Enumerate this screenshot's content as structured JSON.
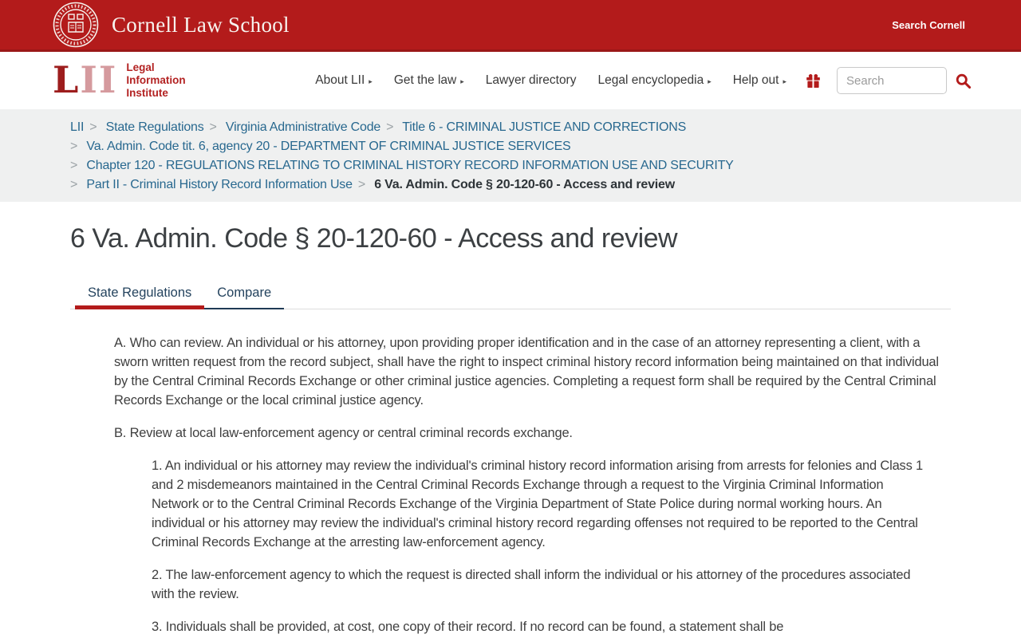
{
  "header": {
    "university": "Cornell Law School",
    "search_cornell": "Search Cornell"
  },
  "nav": {
    "logo": {
      "l": "L",
      "ii": "II",
      "line1": "Legal",
      "line2": "Information",
      "line3": "Institute"
    },
    "arrow": "▸",
    "items": [
      {
        "label": "About LII",
        "has_arrow": true
      },
      {
        "label": "Get the law",
        "has_arrow": true
      },
      {
        "label": "Lawyer directory",
        "has_arrow": false
      },
      {
        "label": "Legal encyclopedia",
        "has_arrow": true
      },
      {
        "label": "Help out",
        "has_arrow": true
      }
    ],
    "search": {
      "placeholder": "Search"
    }
  },
  "breadcrumb": {
    "separator": ">",
    "links": [
      "LII",
      "State Regulations",
      "Virginia Administrative Code",
      "Title 6 - CRIMINAL JUSTICE AND CORRECTIONS",
      "Va. Admin. Code tit. 6, agency 20 - DEPARTMENT OF CRIMINAL JUSTICE SERVICES",
      "Chapter 120 - REGULATIONS RELATING TO CRIMINAL HISTORY RECORD INFORMATION USE AND SECURITY",
      "Part II - Criminal History Record Information Use"
    ],
    "current": "6 Va. Admin. Code § 20-120-60 - Access and review"
  },
  "main": {
    "title": "6 Va. Admin. Code § 20-120-60 - Access and review",
    "tabs": [
      {
        "label": "State Regulations",
        "active": true
      },
      {
        "label": "Compare",
        "active": false
      }
    ],
    "paragraphs": [
      {
        "level": 1,
        "text": "A. Who can review. An individual or his attorney, upon providing proper identification and in the case of an attorney representing a client, with a sworn written request from the record subject, shall have the right to inspect criminal history record information being maintained on that individual by the Central Criminal Records Exchange or other criminal justice agencies. Completing a request form shall be required by the Central Criminal Records Exchange or the local criminal justice agency."
      },
      {
        "level": 1,
        "text": "B. Review at local law-enforcement agency or central criminal records exchange."
      },
      {
        "level": 2,
        "text": "1. An individual or his attorney may review the individual's criminal history record information arising from arrests for felonies and Class 1 and 2 misdemeanors maintained in the Central Criminal Records Exchange through a request to the Virginia Criminal Information Network or to the Central Criminal Records Exchange of the Virginia Department of State Police during normal working hours. An individual or his attorney may review the individual's criminal history record regarding offenses not required to be reported to the Central Criminal Records Exchange at the arresting law-enforcement agency."
      },
      {
        "level": 2,
        "text": "2. The law-enforcement agency to which the request is directed shall inform the individual or his attorney of the procedures associated with the review."
      },
      {
        "level": 2,
        "text": "3. Individuals shall be provided, at cost, one copy of their record. If no record can be found, a statement shall be"
      }
    ]
  },
  "colors": {
    "cornell_red": "#b31b1b",
    "banner_edge": "#9a1717",
    "breadcrumb_link_blue": "#28688f",
    "tab_navy": "#24435e",
    "body_text": "#3f3f3f",
    "breadcrumb_bg": "#eff0f0"
  }
}
